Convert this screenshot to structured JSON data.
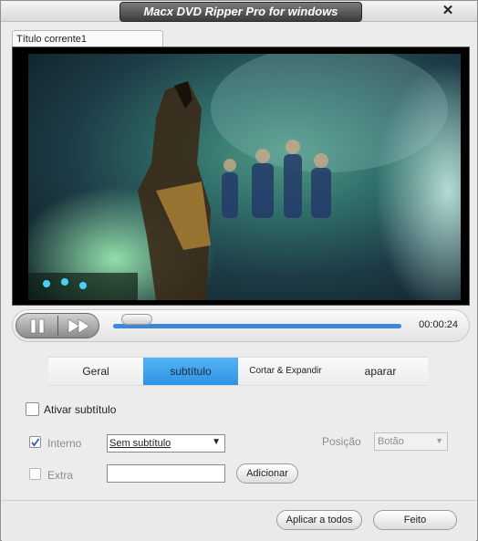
{
  "window": {
    "title": "Macx DVD Ripper Pro for windows",
    "close": "✕"
  },
  "preview": {
    "tab_label": "Título corrente1",
    "time": "00:00:24",
    "progress": 0.03
  },
  "tabs": [
    {
      "label": "Geral",
      "active": false
    },
    {
      "label": "subtítulo",
      "active": true
    },
    {
      "label": "Cortar & Expandir",
      "active": false
    },
    {
      "label": "aparar",
      "active": false
    }
  ],
  "subtitle": {
    "enable_label": "Ativar subtítulo",
    "enable_checked": false,
    "interno_label": "Interno",
    "interno_checked": true,
    "interno_value": "Sem subtítulo",
    "extra_label": "Extra",
    "extra_checked": false,
    "extra_value": "",
    "add_label": "Adicionar",
    "posicao_label": "Posição",
    "posicao_value": "Botão"
  },
  "footer": {
    "apply_all_label": "Aplicar a todos",
    "done_label": "Feito"
  },
  "colors": {
    "accent": "#3a9be8",
    "progress": "#3f86d6"
  },
  "icons": [
    "close-icon",
    "pause-icon",
    "fast-forward-icon",
    "check-icon",
    "dropdown-arrow-icon"
  ]
}
